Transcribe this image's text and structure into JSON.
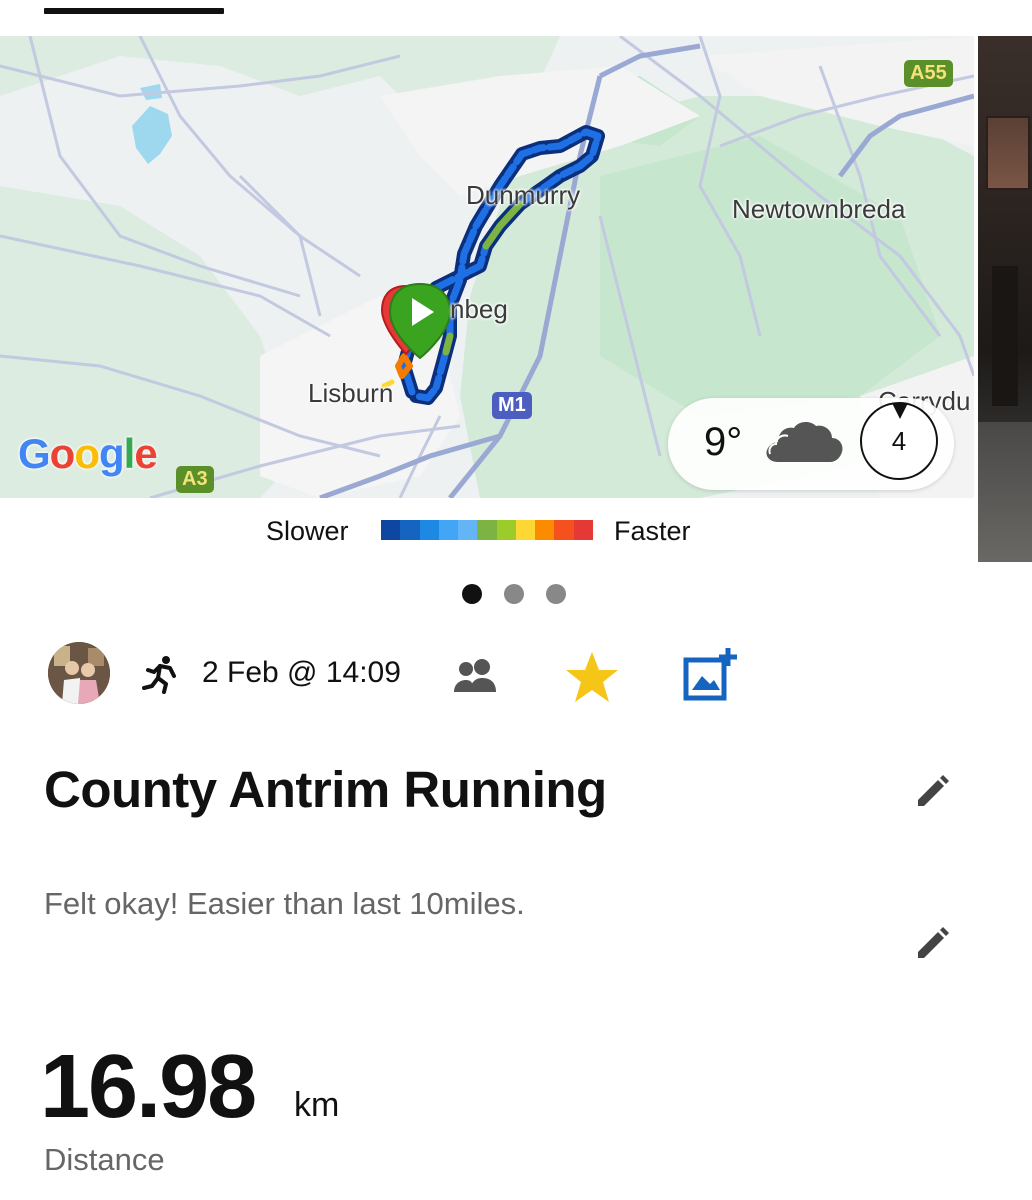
{
  "map": {
    "places": {
      "dunmurry": "Dunmurry",
      "newtownbreda": "Newtownbreda",
      "lambeg": "nbeg",
      "lisburn": "Lisburn",
      "carryduff": "Carrydu"
    },
    "roads": {
      "a55": "A55",
      "m1": "M1",
      "a3": "A3"
    },
    "google_logo": "Google",
    "route_color": "#1f6fe5",
    "start_marker_color": "#3aa320",
    "end_marker_color": "#e53935"
  },
  "weather": {
    "temp": "9°",
    "icon": "cloud-icon",
    "wind": "4"
  },
  "legend": {
    "slower": "Slower",
    "faster": "Faster",
    "colors": [
      "#0d47a1",
      "#1565c0",
      "#1e88e5",
      "#42a5f5",
      "#64b5f6",
      "#7cb342",
      "#9ccc2a",
      "#fdd835",
      "#fb8c00",
      "#f4511e",
      "#e53935"
    ]
  },
  "pager": {
    "count": 3,
    "active": 0
  },
  "activity": {
    "type_icon": "running-icon",
    "date": "2 Feb @ 14:09",
    "favourite_color": "#f5c518",
    "accent_color": "#1565c0",
    "title": "County Antrim Running",
    "note": "Felt okay! Easier than last 10miles.",
    "distance_value": "16.98",
    "distance_unit": "km",
    "distance_label": "Distance"
  }
}
